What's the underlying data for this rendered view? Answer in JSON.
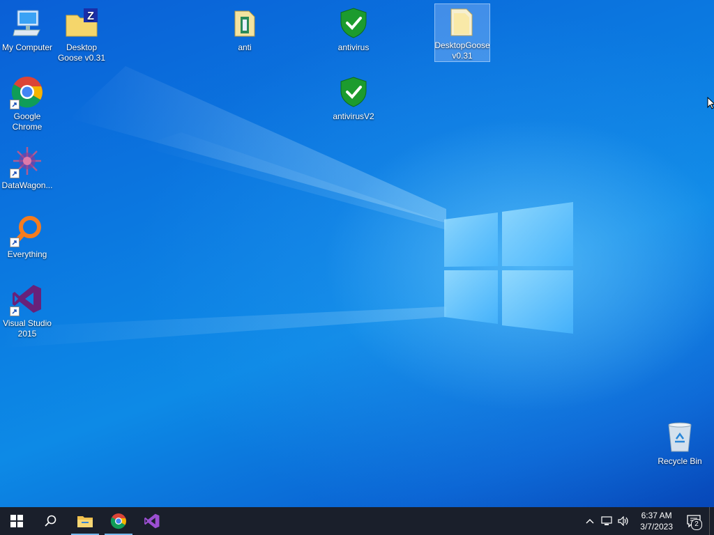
{
  "desktop_icons": {
    "my_computer": "My Computer",
    "desktop_goose": "Desktop Goose v0.31",
    "anti": "anti",
    "antivirus": "antivirus",
    "desktop_goose_folder": "DesktopGoose v0.31",
    "antivirus_v2": "antivirusV2",
    "google_chrome": "Google Chrome",
    "datawagon": "DataWagon...",
    "everything": "Everything",
    "visual_studio": "Visual Studio 2015",
    "recycle_bin": "Recycle Bin"
  },
  "taskbar": {
    "pinned": [
      "start-button",
      "search",
      "file-explorer",
      "google-chrome",
      "visual-studio"
    ],
    "clock": {
      "time": "6:37 AM",
      "date": "3/7/2023"
    },
    "notification_count": "2"
  },
  "colors": {
    "accent": "#0b78e0",
    "taskbar": "#1a1f2b",
    "selection": "#aac8ff"
  }
}
